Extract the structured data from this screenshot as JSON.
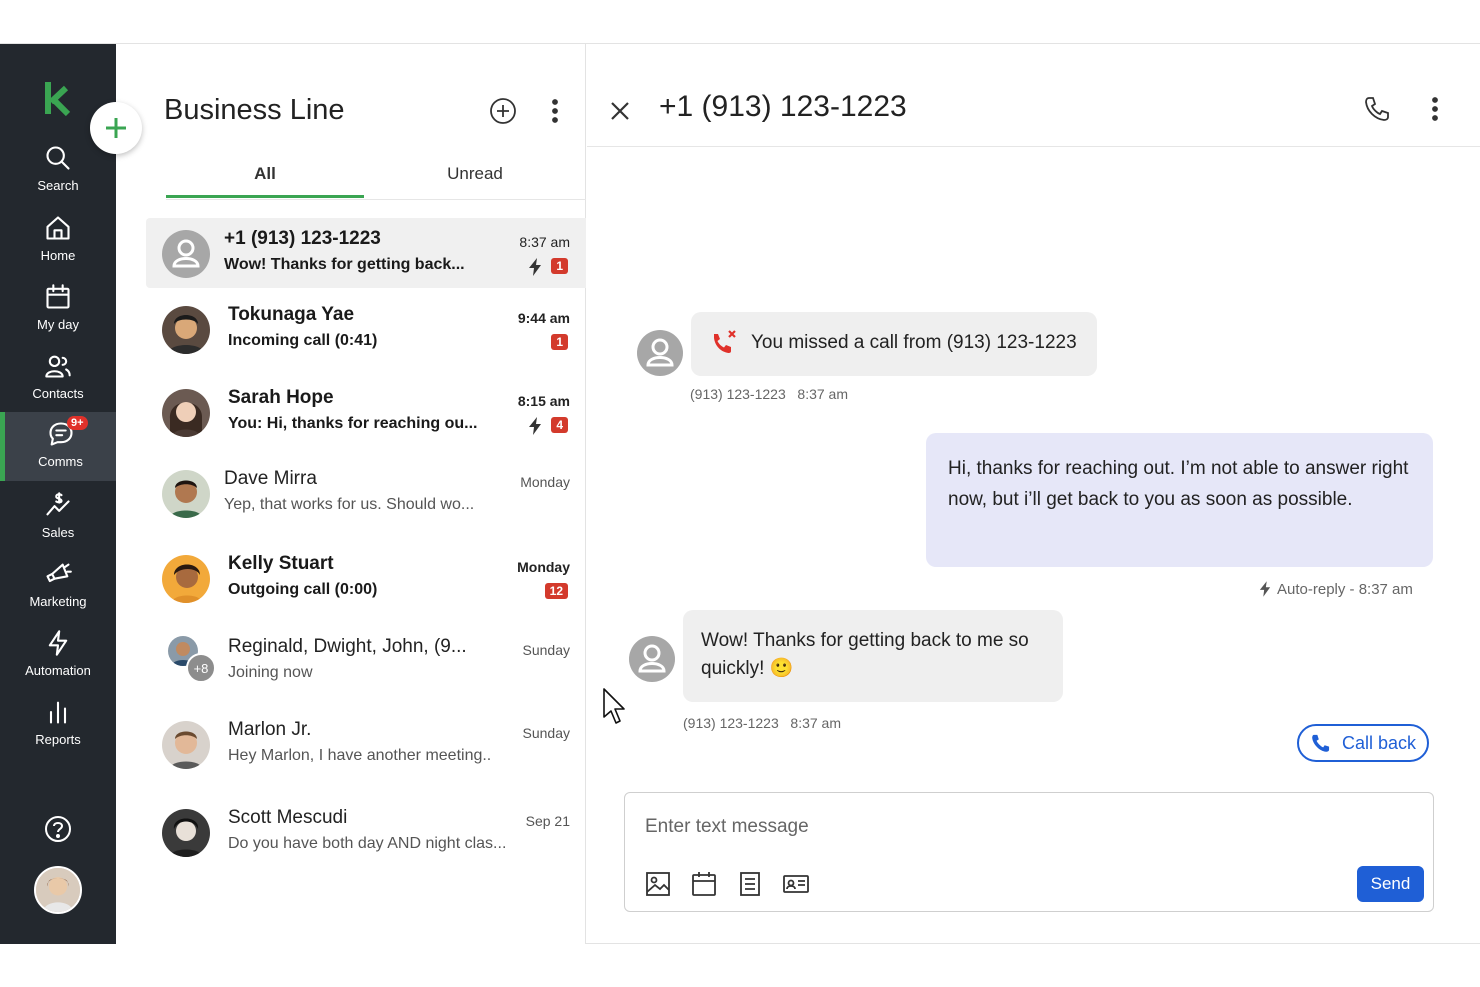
{
  "rail": {
    "items": [
      {
        "label": "Search",
        "icon": "search-icon"
      },
      {
        "label": "Home",
        "icon": "home-icon"
      },
      {
        "label": "My day",
        "icon": "calendar-icon"
      },
      {
        "label": "Contacts",
        "icon": "contacts-icon"
      },
      {
        "label": "Comms",
        "icon": "chat-icon",
        "badge": "9+",
        "active": true
      },
      {
        "label": "Sales",
        "icon": "sales-icon"
      },
      {
        "label": "Marketing",
        "icon": "megaphone-icon"
      },
      {
        "label": "Automation",
        "icon": "bolt-icon"
      },
      {
        "label": "Reports",
        "icon": "bar-chart-icon"
      }
    ],
    "accent": "#3aa552"
  },
  "list": {
    "title": "Business Line",
    "tabs": [
      {
        "label": "All"
      },
      {
        "label": "Unread"
      }
    ],
    "conversations": [
      {
        "name": "+1 (913) 123-1223",
        "preview": "Wow! Thanks for getting back...",
        "time": "8:37 am",
        "badge": "1"
      },
      {
        "name": "Tokunaga Yae",
        "preview": "Incoming call (0:41)",
        "time": "9:44 am",
        "badge": "1"
      },
      {
        "name": "Sarah Hope",
        "preview": "You: Hi, thanks for reaching ou...",
        "time": "8:15 am",
        "badge": "4"
      },
      {
        "name": "Dave Mirra",
        "preview": "Yep, that works for us. Should wo...",
        "time": "Monday"
      },
      {
        "name": "Kelly Stuart",
        "preview": "Outgoing call (0:00)",
        "time": "Monday",
        "badge": "12"
      },
      {
        "name": "Reginald, Dwight, John, (9...",
        "preview": "Joining now",
        "time": "Sunday",
        "group_extra": "+8"
      },
      {
        "name": "Marlon Jr.",
        "preview": "Hey Marlon, I have another meeting..",
        "time": "Sunday"
      },
      {
        "name": "Scott Mescudi",
        "preview": "Do you have both day AND night clas...",
        "time": "Sep 21"
      }
    ]
  },
  "pane": {
    "title": "+1 (913) 123-1223",
    "messages": [
      {
        "text": "You missed a call from (913) 123-1223",
        "meta": "(913) 123-1223   8:37 am"
      },
      {
        "text": "Hi, thanks for reaching out. I’m not able to answer right now, but i’ll get back to you as soon as possible.",
        "meta": "Auto-reply - 8:37 am"
      },
      {
        "text": "Wow! Thanks for getting back to me so quickly! 🙂",
        "meta": "(913) 123-1223   8:37 am"
      }
    ],
    "callback_label": "Call back",
    "compose_placeholder": "Enter text message",
    "send_label": "Send",
    "primary_color": "#1f5fd6"
  }
}
